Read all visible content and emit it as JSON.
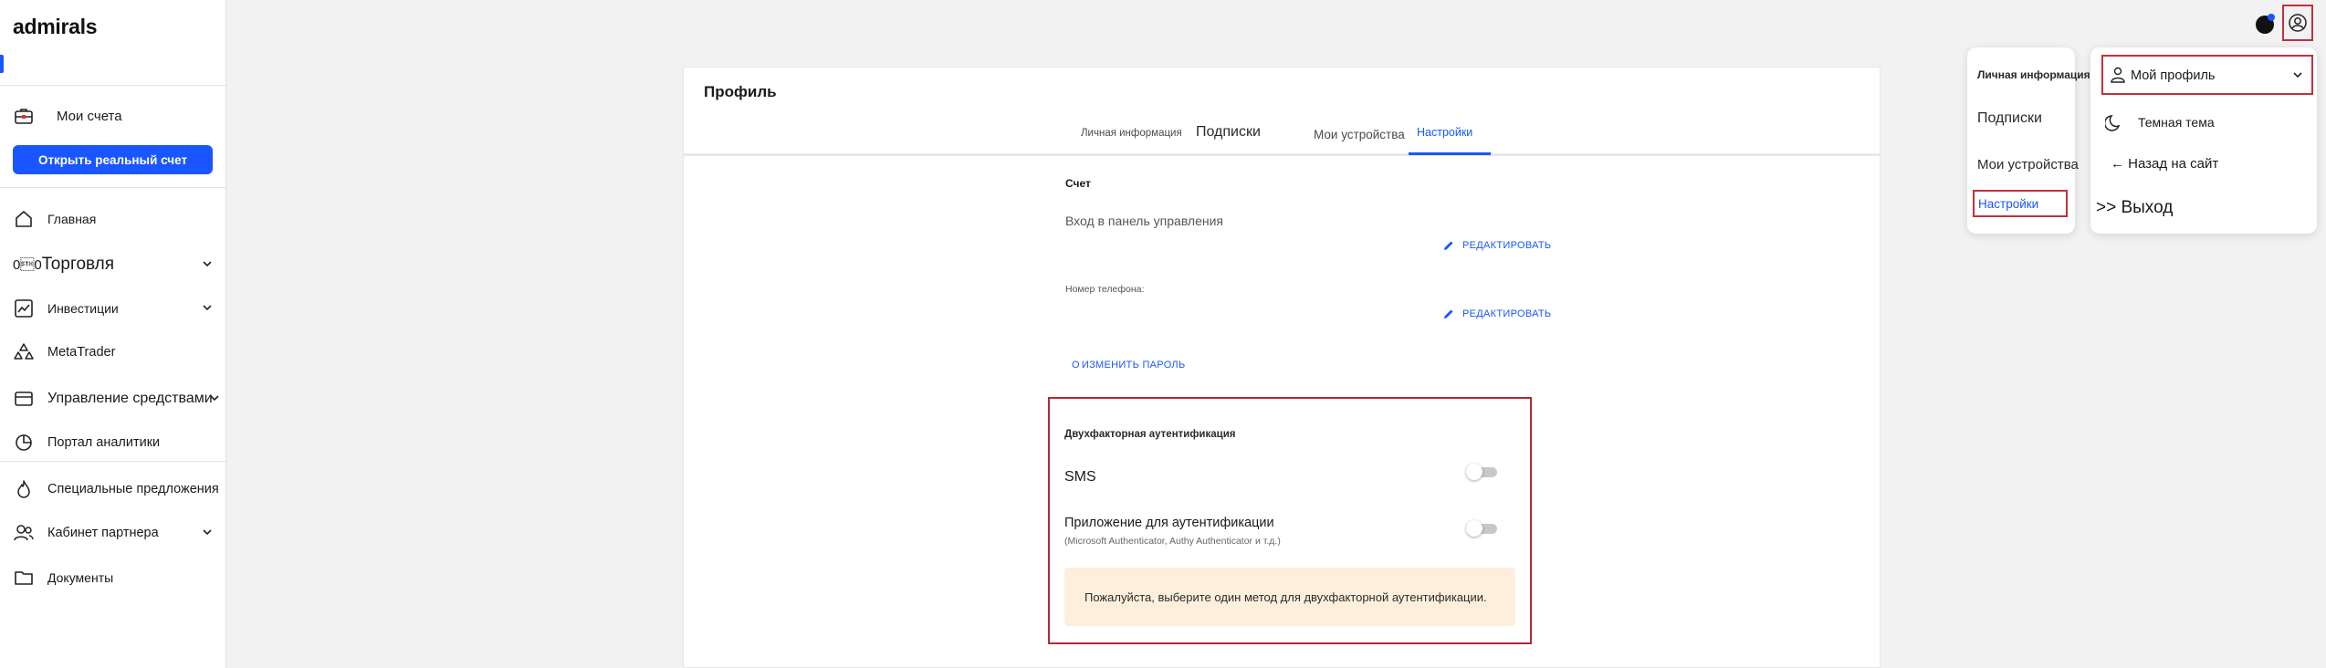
{
  "brand": {
    "logo_text": "admirals",
    "accent": "#1a56ff",
    "highlight": "#c0313a"
  },
  "sidebar": {
    "my_accounts": {
      "label": "Мои счета",
      "icon": "briefcase-icon"
    },
    "open_account_button": "Открыть реальный счет",
    "items": [
      {
        "label": "Главная",
        "icon": "home-icon"
      },
      {
        "prefix": "0\u00020",
        "label": "Торговля",
        "icon": "chevron-down-icon"
      },
      {
        "label": "Инвестиции",
        "icon": "trend-chart-icon"
      },
      {
        "label": "MetaTrader",
        "icon": "metatrader-icon"
      },
      {
        "label": "Управление средствами",
        "icon": "wallet-icon"
      },
      {
        "label": "Портал аналитики",
        "icon": "pie-chart-icon"
      },
      {
        "label": "Специальные предложения",
        "icon": "flame-icon"
      },
      {
        "label": "Кабинет партнера",
        "icon": "partners-icon"
      },
      {
        "label": "Документы",
        "icon": "folder-icon"
      }
    ]
  },
  "profile": {
    "title": "Профиль",
    "tabs": [
      {
        "label": "Личная информация"
      },
      {
        "label": "Подписки"
      },
      {
        "label": "Мои устройства"
      },
      {
        "label": "Настройки"
      }
    ],
    "account_label": "Счет",
    "dashboard_login_label": "Вход в панель управления",
    "edit_label": "РЕДАКТИРОВАТЬ",
    "phone_label": "Номер телефона:",
    "change_password_prefix": "О",
    "change_password_label": "ИЗМЕНИТЬ ПАРОЛЬ"
  },
  "twofa": {
    "title": "Двухфакторная аутентификация",
    "sms_label": "SMS",
    "sms_enabled": false,
    "app_label": "Приложение для аутентификации",
    "app_hint": "(Microsoft Authenticator, Authy Authenticator и т.д.)",
    "app_enabled": false,
    "notice": "Пожалуйста, выберите один метод для двухфакторной аутентификации."
  },
  "tab_menu_panel": {
    "items": [
      "Личная информация",
      "Подписки",
      "Мои устройства",
      "Настройки"
    ]
  },
  "user_menu_panel": {
    "profile_label": "Мой профиль",
    "dark_theme_label": "Темная тема",
    "back_label": "← Назад на сайт",
    "logout_label": ">> Выход"
  }
}
